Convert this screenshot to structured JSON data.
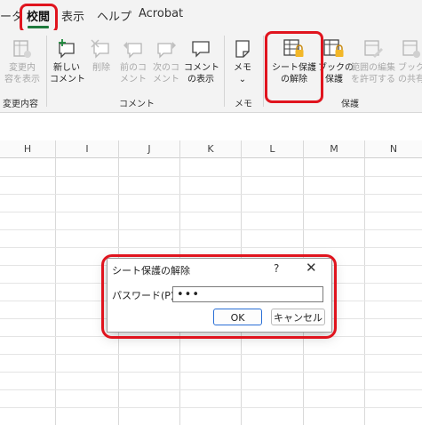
{
  "tabs": [
    {
      "label": "ータ"
    },
    {
      "label": "校閲"
    },
    {
      "label": "表示"
    },
    {
      "label": "ヘルプ"
    },
    {
      "label": "Acrobat"
    }
  ],
  "ribbon": {
    "changes": {
      "btn1_l1": "変更内",
      "btn1_l2": "容を表示",
      "group": "変更内容"
    },
    "comments": {
      "new_l1": "新しい",
      "new_l2": "コメント",
      "delete": "削除",
      "prev_l1": "前のコ",
      "prev_l2": "メント",
      "next_l1": "次のコ",
      "next_l2": "メント",
      "show_l1": "コメント",
      "show_l2": "の表示",
      "group": "コメント"
    },
    "notes": {
      "memo": "メモ",
      "chevron": "⌄",
      "group": "メモ"
    },
    "protect": {
      "unprotect_l1": "シート保護",
      "unprotect_l2": "の解除",
      "book_l1": "ブックの",
      "book_l2": "保護",
      "range_l1": "範囲の編集",
      "range_l2": "を許可する",
      "share_l1": "ブック",
      "share_l2": "の共有",
      "group": "保護"
    }
  },
  "columns": [
    "H",
    "I",
    "J",
    "K",
    "L",
    "M",
    "N"
  ],
  "dialog": {
    "title": "シート保護の解除",
    "help": "?",
    "close": "✕",
    "password_label": "パスワード(P):",
    "password_value": "•••",
    "ok": "OK",
    "cancel": "キャンセル"
  },
  "colors": {
    "highlight": "#e0141e",
    "accent_green": "#1f7a3d"
  }
}
